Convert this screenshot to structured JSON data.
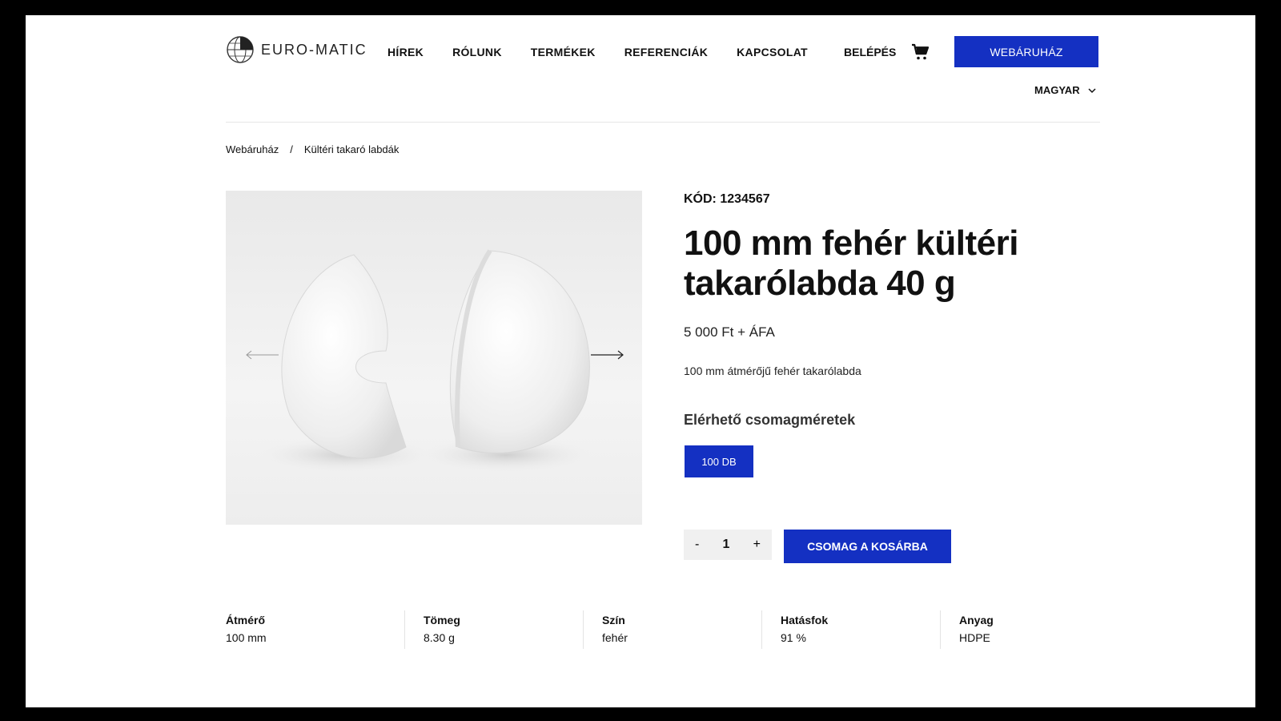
{
  "header": {
    "logo_text": "EURO-MATIC",
    "nav": [
      "HÍREK",
      "RÓLUNK",
      "TERMÉKEK",
      "REFERENCIÁK",
      "KAPCSOLAT"
    ],
    "login": "BELÉPÉS",
    "shop_button": "WEBÁRUHÁZ",
    "language": "MAGYAR",
    "accent_color": "#1430c2"
  },
  "breadcrumb": {
    "items": [
      "Webáruház",
      "Kültéri takaró labdák"
    ],
    "separator": "/"
  },
  "product": {
    "code": "KÓD: 1234567",
    "title": "100 mm fehér kültéri takarólabda 40 g",
    "price": "5 000 Ft + ÁFA",
    "description": "100 mm átmérőjű fehér takarólabda",
    "packages_title": "Elérhető csomagméretek",
    "package_option": "100 DB",
    "quantity": "1",
    "minus": "-",
    "plus": "+",
    "add_to_cart": "CSOMAG A KOSÁRBA"
  },
  "specs": [
    {
      "label": "Átmérő",
      "value": "100 mm"
    },
    {
      "label": "Tömeg",
      "value": "8.30 g"
    },
    {
      "label": "Szín",
      "value": "fehér"
    },
    {
      "label": "Hatásfok",
      "value": "91 %"
    },
    {
      "label": "Anyag",
      "value": "HDPE"
    }
  ],
  "icons": [
    "globe-logo-icon",
    "cart-icon",
    "chevron-down-icon",
    "arrow-left-icon",
    "arrow-right-icon"
  ]
}
